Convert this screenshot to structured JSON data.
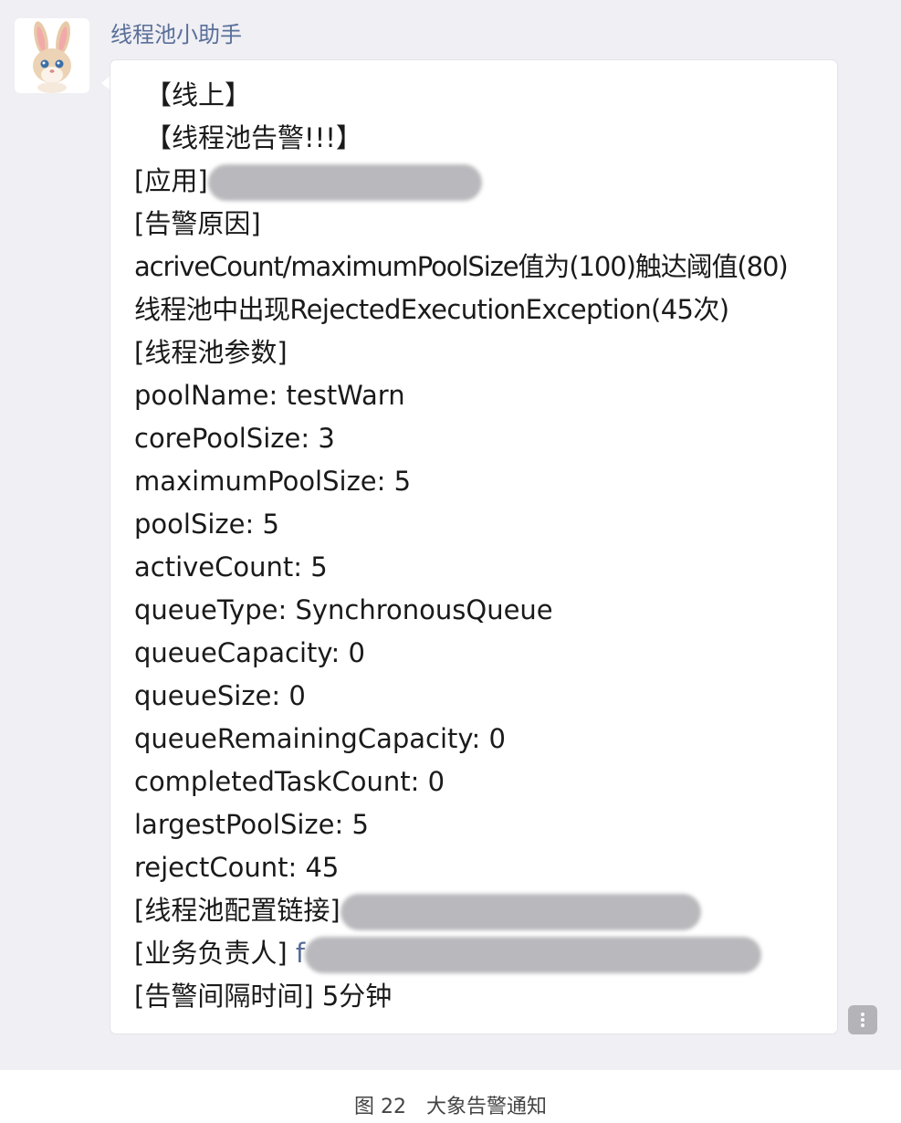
{
  "sender": {
    "name": "线程池小助手",
    "avatar_icon": "rabbit-avatar-icon"
  },
  "message": {
    "env": "【线上】",
    "alert_title": "【线程池告警!!!】",
    "app_label": "[应用]",
    "reason_label": "[告警原因]",
    "reason_1": "acriveCount/maximumPoolSize值为(100)触达阈值(80)",
    "reason_2": "线程池中出现RejectedExecutionException(45次)",
    "params_label": "[线程池参数]",
    "params": [
      "poolName: testWarn",
      "corePoolSize: 3",
      "maximumPoolSize: 5",
      "poolSize: 5",
      "activeCount: 5",
      "queueType: SynchronousQueue",
      "queueCapacity: 0",
      "queueSize: 0",
      "queueRemainingCapacity: 0",
      "completedTaskCount: 0",
      "largestPoolSize: 5",
      "rejectCount: 45"
    ],
    "config_link_label": "[线程池配置链接]",
    "owner_label": "[业务负责人]",
    "owner_value_visible": "f",
    "interval_label": "[告警间隔时间]",
    "interval_value": "5分钟"
  },
  "more_button_icon": "more-vertical-icon",
  "caption": "图 22　大象告警通知",
  "colors": {
    "chat_background": "#efeff4",
    "sender_name": "#5a6f98",
    "link": "#576b95",
    "bubble": "#ffffff"
  }
}
